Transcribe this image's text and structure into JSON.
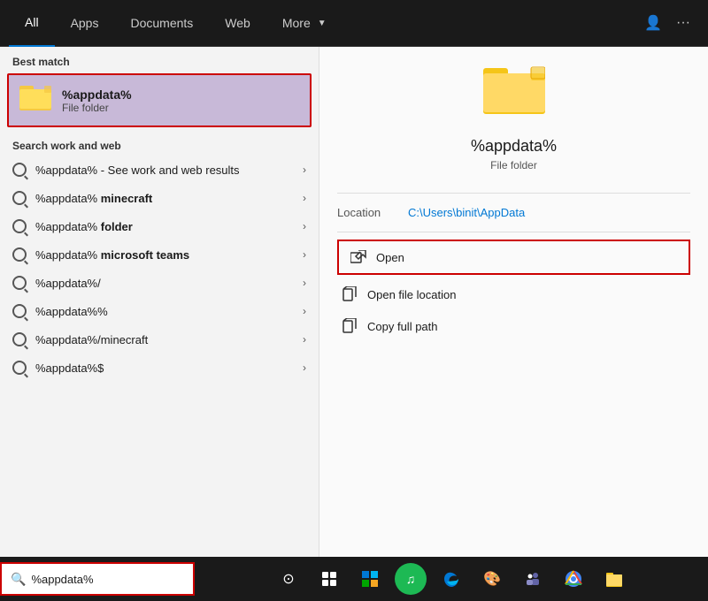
{
  "nav": {
    "tabs": [
      {
        "label": "All",
        "active": true
      },
      {
        "label": "Apps",
        "active": false
      },
      {
        "label": "Documents",
        "active": false
      },
      {
        "label": "Web",
        "active": false
      },
      {
        "label": "More",
        "active": false,
        "has_arrow": true
      }
    ]
  },
  "best_match": {
    "title": "%appdata%",
    "subtitle": "File folder",
    "section_label": "Best match"
  },
  "search_section_label": "Search work and web",
  "results": [
    {
      "text_plain": "%appdata%",
      "text_suffix": " - See work and web results",
      "bold": false
    },
    {
      "text_plain": "%appdata%",
      "text_suffix": " minecraft",
      "bold_suffix": true
    },
    {
      "text_plain": "%appdata%",
      "text_suffix": " folder",
      "bold_suffix": true
    },
    {
      "text_plain": "%appdata%",
      "text_suffix": " microsoft teams",
      "bold_suffix": true
    },
    {
      "text_plain": "%appdata%/",
      "text_suffix": "",
      "bold_suffix": false
    },
    {
      "text_plain": "%appdata%%",
      "text_suffix": "",
      "bold_suffix": false
    },
    {
      "text_plain": "%appdata%",
      "text_suffix": "/minecraft",
      "bold_suffix": false
    },
    {
      "text_plain": "%appdata%$",
      "text_suffix": "",
      "bold_suffix": false
    }
  ],
  "right_panel": {
    "folder_name": "%appdata%",
    "folder_type": "File folder",
    "location_label": "Location",
    "location_value": "C:\\Users\\binit\\AppData",
    "actions": [
      {
        "label": "Open",
        "icon": "open-icon"
      },
      {
        "label": "Open file location",
        "icon": "open-location-icon"
      },
      {
        "label": "Copy full path",
        "icon": "copy-path-icon"
      }
    ]
  },
  "taskbar": {
    "search_placeholder": "%appdata%",
    "icons": [
      {
        "name": "start-icon",
        "symbol": "⊙"
      },
      {
        "name": "task-view-icon",
        "symbol": "▦"
      },
      {
        "name": "store-icon",
        "symbol": "🪟"
      },
      {
        "name": "spotify-icon",
        "symbol": "♫"
      },
      {
        "name": "edge-icon",
        "symbol": "🌐"
      },
      {
        "name": "paint-icon",
        "symbol": "🎨"
      },
      {
        "name": "teams-icon",
        "symbol": "👥"
      },
      {
        "name": "chrome-icon",
        "symbol": "🔵"
      },
      {
        "name": "explorer-icon",
        "symbol": "📁"
      }
    ]
  }
}
